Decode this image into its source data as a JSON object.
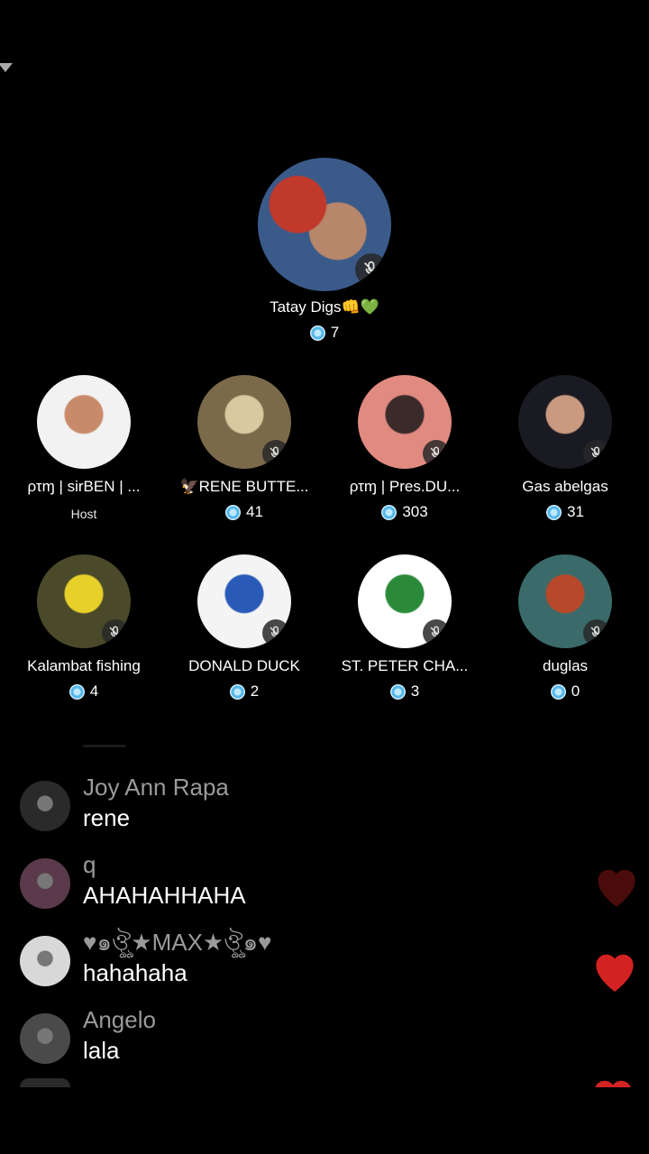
{
  "host": {
    "name": "Tatay Digs👊💚",
    "count": "7",
    "avatar_color": "#3a5a8a",
    "avatar_accent": "#c0392b"
  },
  "seats": [
    {
      "name": "ρτɱ | sirBEN | ...",
      "sub": "Host",
      "avatar_color": "#f2f2f2",
      "avatar_accent": "#c98a6a",
      "muted": false
    },
    {
      "name": "🦅RENE BUTTE...",
      "count": "41",
      "avatar_color": "#7a6a4a",
      "avatar_accent": "#d8c9a0",
      "muted": true
    },
    {
      "name": "ρτɱ | Pres.DU...",
      "count": "303",
      "avatar_color": "#e08a80",
      "avatar_accent": "#3a2a2a",
      "muted": true
    },
    {
      "name": "Gas abelgas",
      "count": "31",
      "avatar_color": "#1a1a22",
      "avatar_accent": "#c99a80",
      "muted": true
    },
    {
      "name": "Kalambat fishing",
      "count": "4",
      "avatar_color": "#4a4a2a",
      "avatar_accent": "#e8d02a",
      "muted": true
    },
    {
      "name": "DONALD DUCK",
      "count": "2",
      "avatar_color": "#f4f4f4",
      "avatar_accent": "#2a5ab8",
      "muted": true
    },
    {
      "name": "ST. PETER CHA...",
      "count": "3",
      "avatar_color": "#ffffff",
      "avatar_accent": "#2a8a3a",
      "muted": true
    },
    {
      "name": "duglas",
      "count": "0",
      "avatar_color": "#3a6a6a",
      "avatar_accent": "#b8482a",
      "muted": true
    }
  ],
  "chat": [
    {
      "user": "Joy Ann Rapa",
      "text": "rene",
      "avatar_color": "#2a2a2a"
    },
    {
      "user": "q",
      "text": "AHAHAHHAHA",
      "avatar_color": "#5a3a4a"
    },
    {
      "user": "♥๑ঔৣ★MAX★ঔৣ๑♥",
      "text": "hahahaha",
      "avatar_color": "#d8d8d8"
    },
    {
      "user": "Angelo",
      "text": "lala",
      "avatar_color": "#4a4a4a"
    }
  ],
  "colors": {
    "background": "#000000",
    "heart": "#d32222",
    "muted_text": "#9a9a9a"
  },
  "icons": {
    "mute": "mic-off-icon",
    "coin": "coin-icon",
    "heart": "heart-icon"
  }
}
